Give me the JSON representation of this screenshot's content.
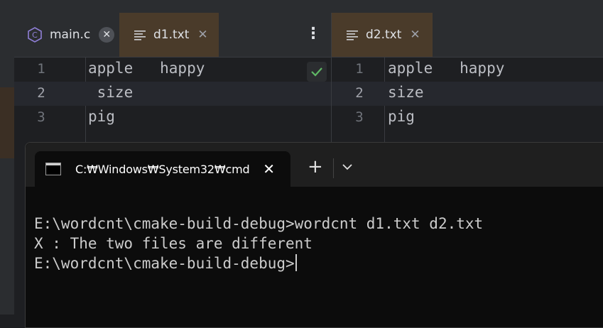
{
  "editor_left": {
    "tabs": [
      {
        "label": "main.c",
        "icon": "c-file-icon",
        "active": false
      },
      {
        "label": "d1.txt",
        "icon": "text-file-icon",
        "active": true
      }
    ],
    "more_icon": "⋮",
    "lines": [
      {
        "num": "1",
        "text": "apple   happy"
      },
      {
        "num": "2",
        "text": " size"
      },
      {
        "num": "3",
        "text": "pig"
      }
    ]
  },
  "editor_right": {
    "tabs": [
      {
        "label": "d2.txt",
        "icon": "text-file-icon",
        "active": true
      }
    ],
    "lines": [
      {
        "num": "1",
        "text": "apple   happy"
      },
      {
        "num": "2",
        "text": "size"
      },
      {
        "num": "3",
        "text": "pig"
      }
    ]
  },
  "terminal": {
    "tab_title": "C:₩Windows₩System32₩cmd",
    "close_icon": "✕",
    "new_tab_icon": "+",
    "lines": [
      "E:\\wordcnt\\cmake-build-debug>wordcnt d1.txt d2.txt",
      "X : The two files are different",
      "E:\\wordcnt\\cmake-build-debug>"
    ]
  },
  "colors": {
    "accent_tab": "#4a3b2a",
    "check": "#5fb865",
    "c_icon": "#8f7fd6"
  }
}
